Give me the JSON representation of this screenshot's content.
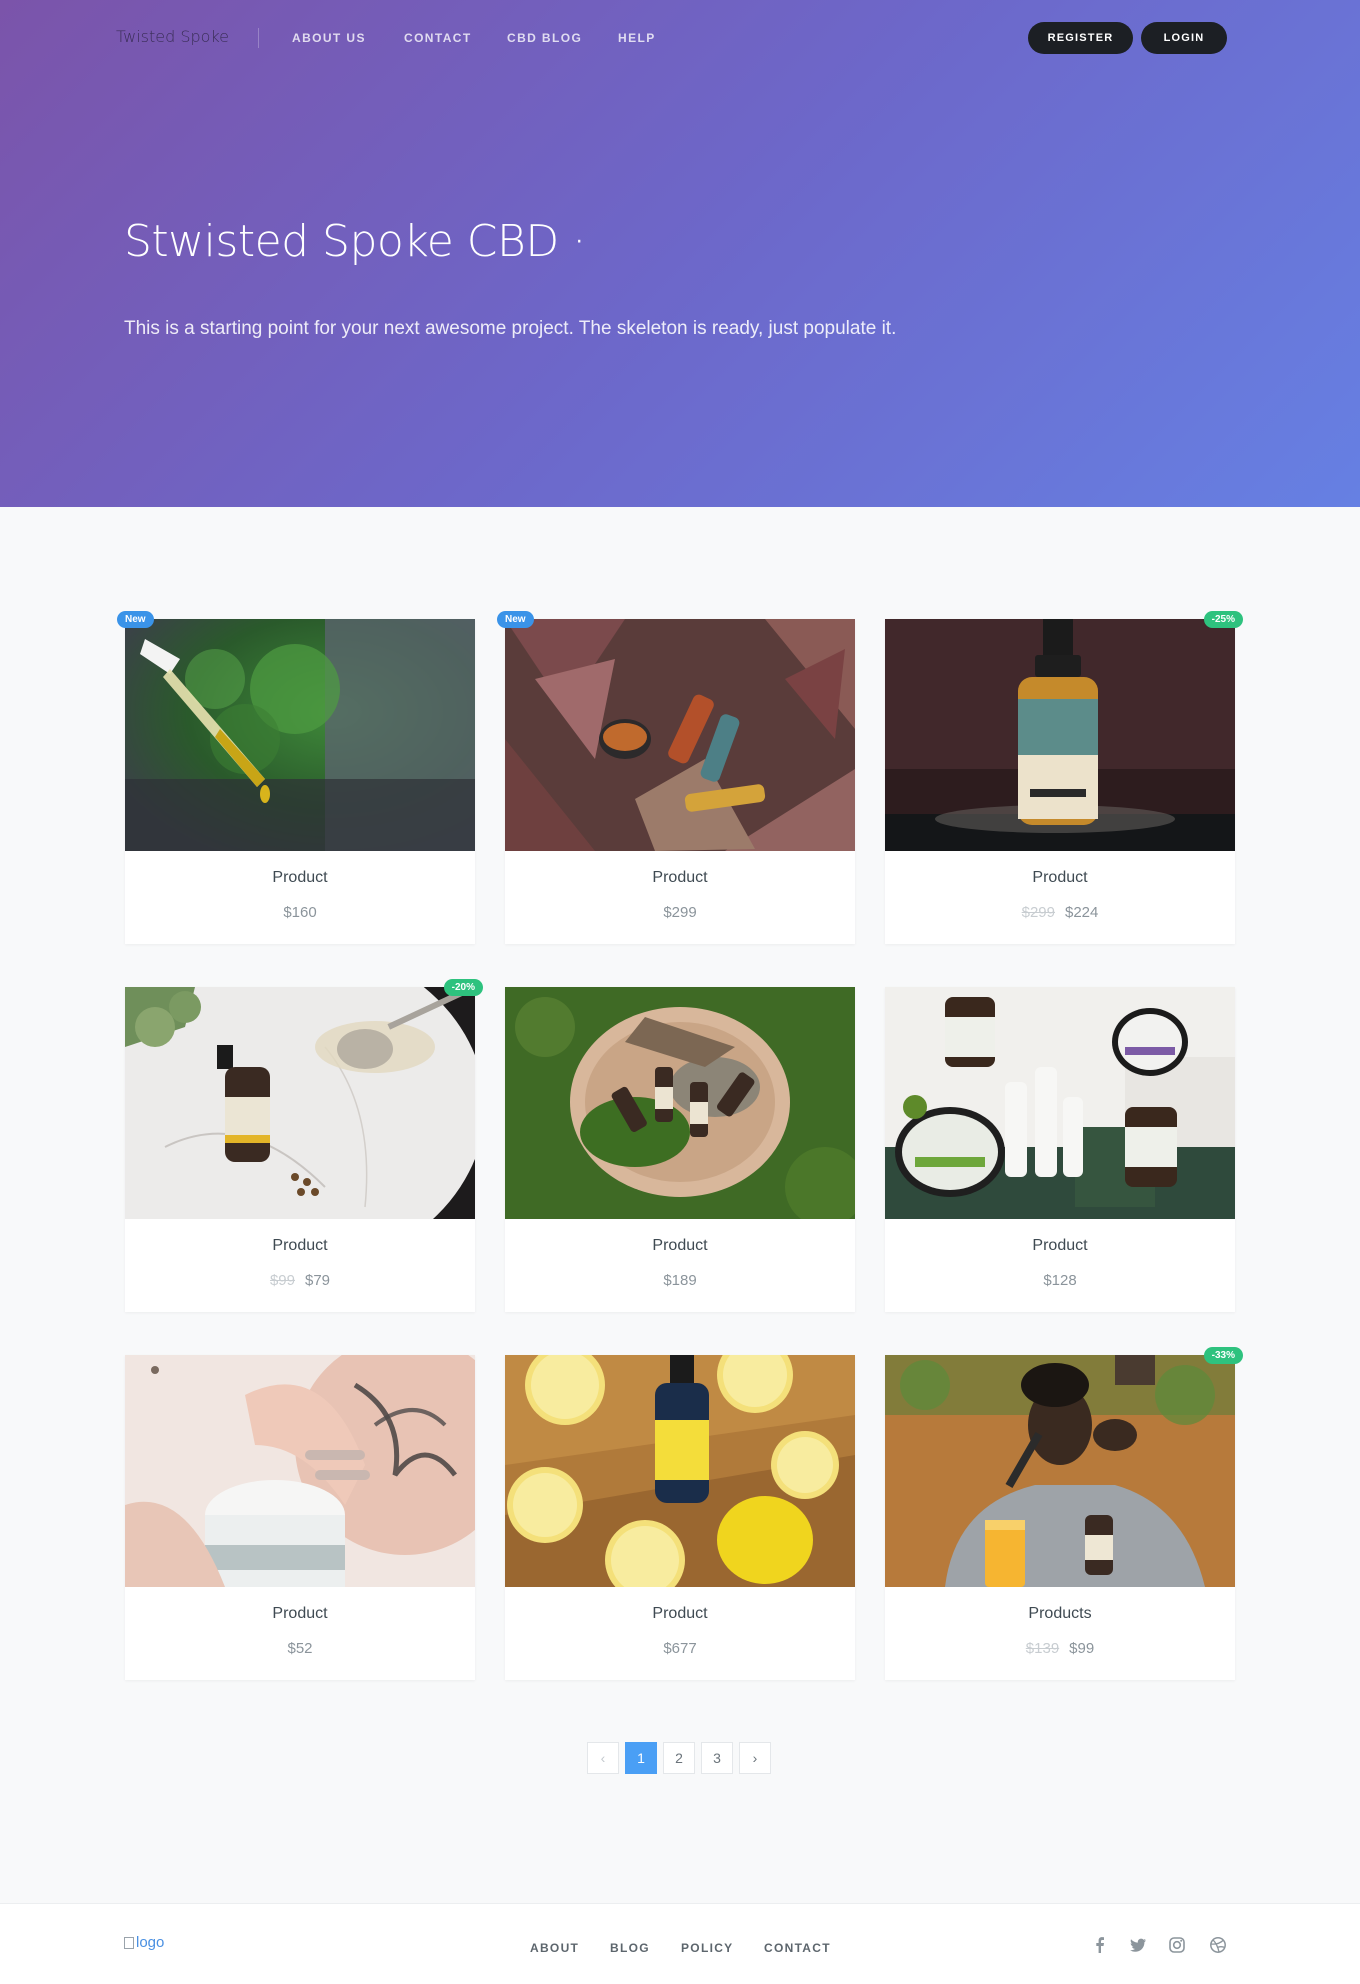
{
  "nav": {
    "brand": "Twisted Spoke",
    "links": [
      "ABOUT US",
      "CONTACT",
      "CBD BLOG",
      "HELP"
    ],
    "register_label": "REGISTER",
    "login_label": "LOGIN"
  },
  "hero": {
    "title": "Stwisted Spoke CBD ·",
    "subtitle": "This is a starting point for your next awesome project. The skeleton is ready, just populate it."
  },
  "products": [
    {
      "name": "Product",
      "price": "$160",
      "old_price": "",
      "badge": "New",
      "image": "cbd-oil-dropper-photo"
    },
    {
      "name": "Product",
      "price": "$299",
      "old_price": "",
      "badge": "New",
      "image": "cbd-products-autumn-leaves-photo"
    },
    {
      "name": "Product",
      "price": "$224",
      "old_price": "$299",
      "badge": "-25%",
      "image": "salveo-hemp-oil-bottle-photo"
    },
    {
      "name": "Product",
      "price": "$79",
      "old_price": "$99",
      "badge": "-20%",
      "image": "cbd-bottle-marble-spoon-photo"
    },
    {
      "name": "Product",
      "price": "$189",
      "old_price": "",
      "badge": "",
      "image": "cbd-bottles-wood-plate-moss-photo"
    },
    {
      "name": "Product",
      "price": "$128",
      "old_price": "",
      "badge": "",
      "image": "cbd-balm-jars-softgels-photo"
    },
    {
      "name": "Product",
      "price": "$52",
      "old_price": "",
      "badge": "",
      "image": "hands-cbd-cream-jar-photo"
    },
    {
      "name": "Product",
      "price": "$677",
      "old_price": "",
      "badge": "",
      "image": "cbd-bottle-lemons-photo"
    },
    {
      "name": "Products",
      "price": "$99",
      "old_price": "$139",
      "badge": "-33%",
      "image": "man-taking-cbd-drops-photo"
    }
  ],
  "pagination": {
    "prev": "‹",
    "pages": [
      "1",
      "2",
      "3"
    ],
    "active": "1",
    "next": "›"
  },
  "footer": {
    "logo_alt": "logo",
    "links": [
      "ABOUT",
      "BLOG",
      "POLICY",
      "CONTACT"
    ],
    "social_icons": [
      "facebook-icon",
      "twitter-icon",
      "instagram-icon",
      "dribbble-icon"
    ]
  },
  "colors": {
    "hero_gradient_start": "#7b54aa",
    "hero_gradient_end": "#6680e3",
    "badge_new": "#3a93e8",
    "badge_sale": "#2ec27e",
    "pagination_active": "#4a9ff5"
  }
}
